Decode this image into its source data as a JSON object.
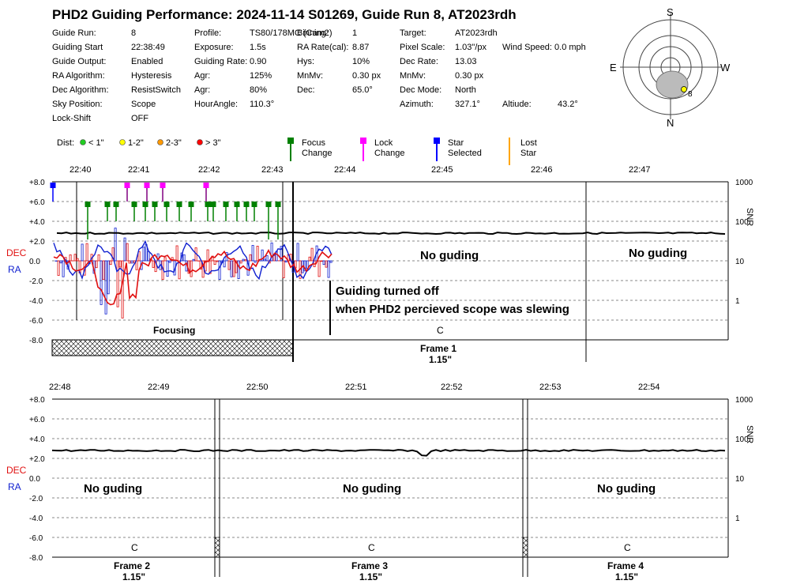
{
  "title": "PHD2 Guiding Performance: 2024-11-14  S01269, Guide Run 8, AT2023rdh",
  "info": {
    "col1": [
      [
        "Guide Run:",
        "8"
      ],
      [
        "Guiding Start",
        "22:38:49"
      ],
      [
        "Guide Output:",
        "Enabled"
      ],
      [
        "RA Algorithm:",
        "Hysteresis"
      ],
      [
        "Dec Algorithm:",
        "ResistSwitch"
      ],
      [
        "Sky Position:",
        "Scope"
      ],
      [
        "Lock-Shift",
        "OFF"
      ]
    ],
    "col2": [
      [
        "Profile:",
        "TS80/178MC (Cam2)"
      ],
      [
        "Exposure:",
        "1.5s"
      ],
      [
        "Guiding Rate:",
        "0.90"
      ],
      [
        "Agr:",
        "125%"
      ],
      [
        "Agr:",
        "80%"
      ],
      [
        "HourAngle:",
        "110.3°"
      ]
    ],
    "col3": [
      [
        "Binning:",
        "1"
      ],
      [
        "RA Rate(cal):",
        "8.87"
      ],
      [
        "Hys:",
        "10%"
      ],
      [
        "MnMv:",
        "0.30 px"
      ],
      [
        "Dec:",
        "65.0°"
      ]
    ],
    "col4": [
      [
        "Target:",
        "AT2023rdh"
      ],
      [
        "Pixel Scale:",
        "1.03\"/px"
      ],
      [
        "Dec Rate:",
        "13.03"
      ],
      [
        "MnMv:",
        "0.30 px"
      ],
      [
        "Dec Mode:",
        "North"
      ],
      [
        "Azimuth:",
        "327.1°"
      ]
    ],
    "wind": "Wind Speed:  0.0 mph",
    "altitude_label": "Altiude:",
    "altitude_value": "43.2°"
  },
  "compass": {
    "N": "N",
    "S": "S",
    "E": "E",
    "W": "W",
    "marker": "8"
  },
  "legend": {
    "dist": "Dist:",
    "d1": "< 1\"",
    "d2": "1-2\"",
    "d3": "2-3\"",
    "d4": "> 3\"",
    "focus1": "Focus",
    "focus2": "Change",
    "lock1": "Lock",
    "lock2": "Change",
    "star1": "Star",
    "star2": "Selected",
    "lost1": "Lost",
    "lost2": "Star"
  },
  "colors": {
    "dec": "#e01010",
    "ra": "#1020d0",
    "focus": "#008000",
    "lock": "#ff00ff",
    "star_selected": "#0000ff",
    "lost_star": "#ffa500",
    "dist1": "#22cc22",
    "dist2": "#ffff00",
    "dist3": "#ff9900",
    "dist4": "#ff0000"
  },
  "chart_data": [
    {
      "type": "line",
      "panel": "top",
      "x_ticks": [
        "22:40",
        "22:41",
        "22:42",
        "22:43",
        "22:44",
        "22:45",
        "22:46",
        "22:47"
      ],
      "y_ticks": [
        "+8.0",
        "+6.0",
        "+4.0",
        "+2.0",
        "0.0",
        "-2.0",
        "-4.0",
        "-6.0",
        "-8.0"
      ],
      "ylim": [
        -8,
        8
      ],
      "snr_ticks": [
        "1000",
        "100",
        "10",
        "1"
      ],
      "snr_label": "SNR",
      "series": [
        {
          "name": "DEC",
          "type": "line"
        },
        {
          "name": "RA",
          "type": "line"
        },
        {
          "name": "SNR",
          "type": "line"
        }
      ],
      "focus_changes": 17,
      "lock_changes": 4,
      "star_selected": 1,
      "annotations": {
        "no_guiding_1": "No guding",
        "no_guiding_2": "No guding",
        "note1": "Guiding turned off",
        "note2": "when PHD2 percieved scope was slewing",
        "focusing": "Focusing",
        "calib": "C",
        "frame": "Frame 1",
        "frame_hfr": "1.15\""
      }
    },
    {
      "type": "line",
      "panel": "bottom",
      "x_ticks": [
        "22:48",
        "22:49",
        "22:50",
        "22:51",
        "22:52",
        "22:53",
        "22:54"
      ],
      "y_ticks": [
        "+8.0",
        "+6.0",
        "+4.0",
        "+2.0",
        "0.0",
        "-2.0",
        "-4.0",
        "-6.0",
        "-8.0"
      ],
      "ylim": [
        -8,
        8
      ],
      "snr_ticks": [
        "1000",
        "100",
        "10",
        "1"
      ],
      "snr_label": "SNR",
      "series": [
        {
          "name": "SNR",
          "type": "line"
        }
      ],
      "annotations": {
        "no_guiding": [
          "No guding",
          "No guding",
          "No guding"
        ],
        "calib": [
          "C",
          "C",
          "C"
        ],
        "frames": [
          "Frame 2",
          "Frame 3",
          "Frame 4"
        ],
        "frame_hfr": [
          "1.15\"",
          "1.15\"",
          "1.15\""
        ]
      }
    }
  ]
}
